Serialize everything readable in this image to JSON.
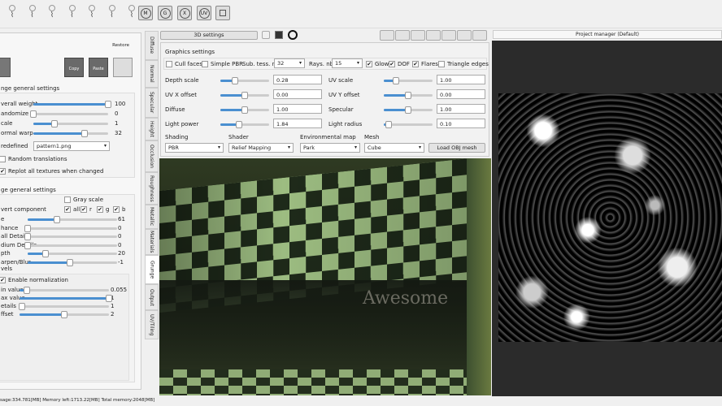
{
  "toolbar": {
    "icons": [
      "normal-icon",
      "height-icon",
      "specular-icon",
      "occlusion-icon",
      "roughness-icon",
      "metallic-icon",
      "grunge-icon"
    ],
    "circle_buttons": [
      "M",
      "G",
      "X",
      "UV"
    ]
  },
  "left": {
    "restore": "Restore",
    "copy": "Copy",
    "paste": "Paste",
    "grunge_header": "nge general settings",
    "grunge_rows": [
      {
        "label": "verall weight",
        "value": "100",
        "pct": 100
      },
      {
        "label": "andomize",
        "value": "0",
        "pct": 0
      },
      {
        "label": "cale",
        "value": "1",
        "pct": 28
      },
      {
        "label": "ormal warp",
        "value": "32",
        "pct": 68
      }
    ],
    "predefined_label": "redefined",
    "predefined_value": "pattern1.png",
    "random_translations": "Random translations",
    "replot": "Replot all textures when changed",
    "general_header": "ge general settings",
    "gray_scale": "Gray scale",
    "invert_label": "vert component",
    "invert_opts": [
      "all",
      "r",
      "g",
      "b"
    ],
    "rows2": [
      {
        "label": "e",
        "value": "61",
        "pct": 33
      },
      {
        "label": "hance",
        "value": "0",
        "pct": 0
      },
      {
        "label": "all Details",
        "value": "0",
        "pct": 0
      },
      {
        "label": "dium Details",
        "value": "0",
        "pct": 0
      },
      {
        "label": "pth",
        "value": "20",
        "pct": 20
      },
      {
        "label": "arpen/Blur",
        "value": "-1",
        "pct": 47
      }
    ],
    "levels_label": "vels",
    "enable_norm": "Enable normalization",
    "rows3": [
      {
        "label": "in value",
        "value": "0.055",
        "pct": 8
      },
      {
        "label": "ax value",
        "value": "1",
        "pct": 100
      },
      {
        "label": "etails",
        "value": "1",
        "pct": 3
      },
      {
        "label": "ffset",
        "value": "2",
        "pct": 50
      }
    ]
  },
  "tabs": [
    "Diffuse",
    "Normal",
    "Specular",
    "Height",
    "Occlusion",
    "Roughness",
    "Metallic",
    "Materials",
    "Grunge",
    "Output",
    "UV/Tiling"
  ],
  "center": {
    "title": "3D settings",
    "graphics": "Graphics settings",
    "cull": "Cull faces",
    "simple_pbr": "Simple PBR",
    "sub_tess": "Sub. tess. nbr",
    "sub_tess_val": "32",
    "rays": "Rays. nbr",
    "rays_val": "15",
    "glow": "Glow",
    "dof": "DOF",
    "flares": "Flares",
    "tri": "Triangle edges",
    "params": [
      {
        "label": "Depth scale",
        "value": "0.28",
        "pct": 30
      },
      {
        "label": "UV scale",
        "value": "1.00",
        "pct": 25
      },
      {
        "label": "UV X offset",
        "value": "0.00",
        "pct": 50
      },
      {
        "label": "UV Y offset",
        "value": "0.00",
        "pct": 50
      },
      {
        "label": "Diffuse",
        "value": "1.00",
        "pct": 50
      },
      {
        "label": "Specular",
        "value": "1.00",
        "pct": 50
      },
      {
        "label": "Light power",
        "value": "1.84",
        "pct": 38
      },
      {
        "label": "Light radius",
        "value": "0.10",
        "pct": 10
      }
    ],
    "shading": "Shading",
    "shading_val": "PBR",
    "shader": "Shader",
    "shader_val": "Relief Mapping",
    "env": "Environmental map",
    "env_val": "Park",
    "mesh": "Mesh",
    "mesh_val": "Cube",
    "load_obj": "Load OBJ mesh",
    "overlay_text": "Awesome"
  },
  "right": {
    "title": "Project manager (Default)"
  },
  "status": "sage:334.781[MB] Memory left:1713.22[MB] Total memory:2048[MB]"
}
